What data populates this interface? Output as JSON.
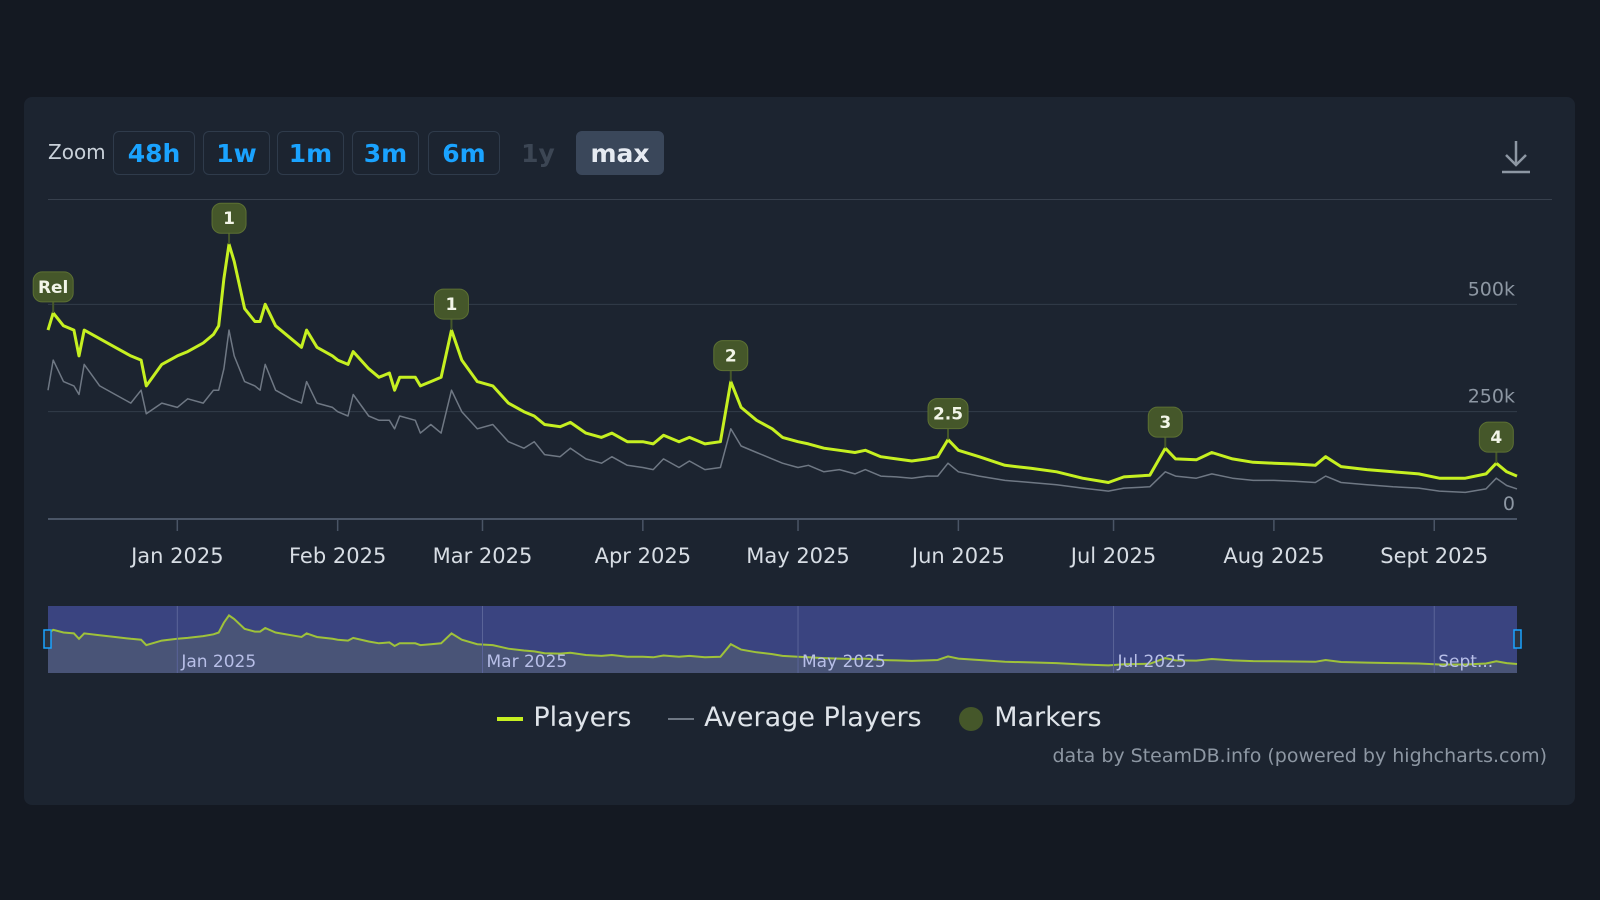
{
  "zoom": {
    "label": "Zoom",
    "buttons": [
      {
        "label": "48h",
        "state": "enabled"
      },
      {
        "label": "1w",
        "state": "enabled"
      },
      {
        "label": "1m",
        "state": "enabled"
      },
      {
        "label": "3m",
        "state": "enabled"
      },
      {
        "label": "6m",
        "state": "enabled"
      },
      {
        "label": "1y",
        "state": "disabled"
      },
      {
        "label": "max",
        "state": "active"
      }
    ]
  },
  "export_icon": "download-icon",
  "colors": {
    "background": "#141922",
    "panel": "#1c2430",
    "players": "#c6f021",
    "average": "#6f7884",
    "marker_fill": "#45572a",
    "zoom_text": "#1aa3ff",
    "navigator_mask": "#3a4480"
  },
  "chart_data": {
    "type": "line",
    "x_start": "2024-12-07",
    "x_end": "2025-09-17",
    "xlabel": "",
    "ylabel": "",
    "y_ticks": [
      0,
      250000,
      500000
    ],
    "y_tick_labels": [
      "0",
      "250k",
      "500k"
    ],
    "ylim": [
      0,
      750000
    ],
    "grid": true,
    "x_tick_labels": [
      "Jan 2025",
      "Feb 2025",
      "Mar 2025",
      "Apr 2025",
      "May 2025",
      "Jun 2025",
      "Jul 2025",
      "Aug 2025",
      "Sept 2025"
    ],
    "x_ticks": [
      "2025-01-01",
      "2025-02-01",
      "2025-03-01",
      "2025-04-01",
      "2025-05-01",
      "2025-06-01",
      "2025-07-01",
      "2025-08-01",
      "2025-09-01"
    ],
    "series": [
      {
        "name": "Players",
        "points": [
          [
            "2024-12-07",
            440000
          ],
          [
            "2024-12-08",
            480000
          ],
          [
            "2024-12-10",
            450000
          ],
          [
            "2024-12-12",
            440000
          ],
          [
            "2024-12-13",
            380000
          ],
          [
            "2024-12-14",
            440000
          ],
          [
            "2024-12-17",
            420000
          ],
          [
            "2024-12-20",
            400000
          ],
          [
            "2024-12-23",
            380000
          ],
          [
            "2024-12-25",
            370000
          ],
          [
            "2024-12-26",
            310000
          ],
          [
            "2024-12-29",
            360000
          ],
          [
            "2025-01-01",
            380000
          ],
          [
            "2025-01-03",
            390000
          ],
          [
            "2025-01-06",
            410000
          ],
          [
            "2025-01-08",
            430000
          ],
          [
            "2025-01-09",
            450000
          ],
          [
            "2025-01-10",
            560000
          ],
          [
            "2025-01-11",
            640000
          ],
          [
            "2025-01-12",
            600000
          ],
          [
            "2025-01-14",
            490000
          ],
          [
            "2025-01-16",
            460000
          ],
          [
            "2025-01-17",
            460000
          ],
          [
            "2025-01-18",
            500000
          ],
          [
            "2025-01-20",
            450000
          ],
          [
            "2025-01-23",
            420000
          ],
          [
            "2025-01-25",
            400000
          ],
          [
            "2025-01-26",
            440000
          ],
          [
            "2025-01-28",
            400000
          ],
          [
            "2025-01-31",
            380000
          ],
          [
            "2025-02-01",
            370000
          ],
          [
            "2025-02-03",
            360000
          ],
          [
            "2025-02-04",
            390000
          ],
          [
            "2025-02-07",
            350000
          ],
          [
            "2025-02-09",
            330000
          ],
          [
            "2025-02-11",
            340000
          ],
          [
            "2025-02-12",
            300000
          ],
          [
            "2025-02-13",
            330000
          ],
          [
            "2025-02-16",
            330000
          ],
          [
            "2025-02-17",
            310000
          ],
          [
            "2025-02-19",
            320000
          ],
          [
            "2025-02-21",
            330000
          ],
          [
            "2025-02-23",
            440000
          ],
          [
            "2025-02-25",
            370000
          ],
          [
            "2025-02-28",
            320000
          ],
          [
            "2025-03-03",
            310000
          ],
          [
            "2025-03-06",
            270000
          ],
          [
            "2025-03-09",
            250000
          ],
          [
            "2025-03-11",
            240000
          ],
          [
            "2025-03-13",
            220000
          ],
          [
            "2025-03-16",
            215000
          ],
          [
            "2025-03-18",
            225000
          ],
          [
            "2025-03-21",
            200000
          ],
          [
            "2025-03-24",
            190000
          ],
          [
            "2025-03-26",
            200000
          ],
          [
            "2025-03-29",
            180000
          ],
          [
            "2025-04-01",
            180000
          ],
          [
            "2025-04-03",
            175000
          ],
          [
            "2025-04-05",
            195000
          ],
          [
            "2025-04-08",
            180000
          ],
          [
            "2025-04-10",
            190000
          ],
          [
            "2025-04-13",
            175000
          ],
          [
            "2025-04-16",
            180000
          ],
          [
            "2025-04-18",
            320000
          ],
          [
            "2025-04-20",
            260000
          ],
          [
            "2025-04-23",
            230000
          ],
          [
            "2025-04-26",
            210000
          ],
          [
            "2025-04-28",
            190000
          ],
          [
            "2025-05-01",
            180000
          ],
          [
            "2025-05-03",
            175000
          ],
          [
            "2025-05-06",
            165000
          ],
          [
            "2025-05-09",
            160000
          ],
          [
            "2025-05-12",
            155000
          ],
          [
            "2025-05-14",
            160000
          ],
          [
            "2025-05-17",
            145000
          ],
          [
            "2025-05-20",
            140000
          ],
          [
            "2025-05-23",
            135000
          ],
          [
            "2025-05-26",
            140000
          ],
          [
            "2025-05-28",
            145000
          ],
          [
            "2025-05-30",
            185000
          ],
          [
            "2025-06-01",
            160000
          ],
          [
            "2025-06-05",
            145000
          ],
          [
            "2025-06-10",
            125000
          ],
          [
            "2025-06-15",
            118000
          ],
          [
            "2025-06-20",
            110000
          ],
          [
            "2025-06-25",
            95000
          ],
          [
            "2025-06-30",
            85000
          ],
          [
            "2025-07-03",
            98000
          ],
          [
            "2025-07-08",
            102000
          ],
          [
            "2025-07-11",
            165000
          ],
          [
            "2025-07-13",
            140000
          ],
          [
            "2025-07-17",
            138000
          ],
          [
            "2025-07-20",
            155000
          ],
          [
            "2025-07-24",
            140000
          ],
          [
            "2025-07-28",
            132000
          ],
          [
            "2025-08-01",
            130000
          ],
          [
            "2025-08-05",
            128000
          ],
          [
            "2025-08-09",
            125000
          ],
          [
            "2025-08-11",
            145000
          ],
          [
            "2025-08-14",
            122000
          ],
          [
            "2025-08-19",
            115000
          ],
          [
            "2025-08-24",
            110000
          ],
          [
            "2025-08-29",
            105000
          ],
          [
            "2025-09-02",
            95000
          ],
          [
            "2025-09-07",
            95000
          ],
          [
            "2025-09-11",
            105000
          ],
          [
            "2025-09-13",
            130000
          ],
          [
            "2025-09-15",
            110000
          ],
          [
            "2025-09-17",
            100000
          ]
        ]
      },
      {
        "name": "Average Players",
        "points": [
          [
            "2024-12-07",
            300000
          ],
          [
            "2024-12-08",
            370000
          ],
          [
            "2024-12-10",
            320000
          ],
          [
            "2024-12-12",
            310000
          ],
          [
            "2024-12-13",
            290000
          ],
          [
            "2024-12-14",
            360000
          ],
          [
            "2024-12-17",
            310000
          ],
          [
            "2024-12-20",
            290000
          ],
          [
            "2024-12-23",
            270000
          ],
          [
            "2024-12-25",
            300000
          ],
          [
            "2024-12-26",
            245000
          ],
          [
            "2024-12-29",
            270000
          ],
          [
            "2025-01-01",
            260000
          ],
          [
            "2025-01-03",
            280000
          ],
          [
            "2025-01-06",
            270000
          ],
          [
            "2025-01-08",
            300000
          ],
          [
            "2025-01-09",
            300000
          ],
          [
            "2025-01-10",
            350000
          ],
          [
            "2025-01-11",
            440000
          ],
          [
            "2025-01-12",
            380000
          ],
          [
            "2025-01-14",
            320000
          ],
          [
            "2025-01-16",
            310000
          ],
          [
            "2025-01-17",
            300000
          ],
          [
            "2025-01-18",
            360000
          ],
          [
            "2025-01-20",
            300000
          ],
          [
            "2025-01-23",
            280000
          ],
          [
            "2025-01-25",
            270000
          ],
          [
            "2025-01-26",
            320000
          ],
          [
            "2025-01-28",
            270000
          ],
          [
            "2025-01-31",
            260000
          ],
          [
            "2025-02-01",
            250000
          ],
          [
            "2025-02-03",
            240000
          ],
          [
            "2025-02-04",
            290000
          ],
          [
            "2025-02-07",
            240000
          ],
          [
            "2025-02-09",
            230000
          ],
          [
            "2025-02-11",
            230000
          ],
          [
            "2025-02-12",
            210000
          ],
          [
            "2025-02-13",
            240000
          ],
          [
            "2025-02-16",
            230000
          ],
          [
            "2025-02-17",
            200000
          ],
          [
            "2025-02-19",
            220000
          ],
          [
            "2025-02-21",
            200000
          ],
          [
            "2025-02-23",
            300000
          ],
          [
            "2025-02-25",
            250000
          ],
          [
            "2025-02-28",
            210000
          ],
          [
            "2025-03-03",
            220000
          ],
          [
            "2025-03-06",
            180000
          ],
          [
            "2025-03-09",
            165000
          ],
          [
            "2025-03-11",
            180000
          ],
          [
            "2025-03-13",
            150000
          ],
          [
            "2025-03-16",
            145000
          ],
          [
            "2025-03-18",
            165000
          ],
          [
            "2025-03-21",
            140000
          ],
          [
            "2025-03-24",
            130000
          ],
          [
            "2025-03-26",
            145000
          ],
          [
            "2025-03-29",
            125000
          ],
          [
            "2025-04-01",
            120000
          ],
          [
            "2025-04-03",
            115000
          ],
          [
            "2025-04-05",
            140000
          ],
          [
            "2025-04-08",
            120000
          ],
          [
            "2025-04-10",
            135000
          ],
          [
            "2025-04-13",
            115000
          ],
          [
            "2025-04-16",
            120000
          ],
          [
            "2025-04-18",
            210000
          ],
          [
            "2025-04-20",
            170000
          ],
          [
            "2025-04-23",
            155000
          ],
          [
            "2025-04-26",
            140000
          ],
          [
            "2025-04-28",
            130000
          ],
          [
            "2025-05-01",
            120000
          ],
          [
            "2025-05-03",
            125000
          ],
          [
            "2025-05-06",
            110000
          ],
          [
            "2025-05-09",
            115000
          ],
          [
            "2025-05-12",
            105000
          ],
          [
            "2025-05-14",
            115000
          ],
          [
            "2025-05-17",
            100000
          ],
          [
            "2025-05-20",
            98000
          ],
          [
            "2025-05-23",
            95000
          ],
          [
            "2025-05-26",
            100000
          ],
          [
            "2025-05-28",
            100000
          ],
          [
            "2025-05-30",
            130000
          ],
          [
            "2025-06-01",
            110000
          ],
          [
            "2025-06-05",
            100000
          ],
          [
            "2025-06-10",
            90000
          ],
          [
            "2025-06-15",
            85000
          ],
          [
            "2025-06-20",
            80000
          ],
          [
            "2025-06-25",
            72000
          ],
          [
            "2025-06-30",
            65000
          ],
          [
            "2025-07-03",
            72000
          ],
          [
            "2025-07-08",
            75000
          ],
          [
            "2025-07-11",
            110000
          ],
          [
            "2025-07-13",
            100000
          ],
          [
            "2025-07-17",
            95000
          ],
          [
            "2025-07-20",
            105000
          ],
          [
            "2025-07-24",
            95000
          ],
          [
            "2025-07-28",
            90000
          ],
          [
            "2025-08-01",
            90000
          ],
          [
            "2025-08-05",
            88000
          ],
          [
            "2025-08-09",
            85000
          ],
          [
            "2025-08-11",
            100000
          ],
          [
            "2025-08-14",
            85000
          ],
          [
            "2025-08-19",
            80000
          ],
          [
            "2025-08-24",
            75000
          ],
          [
            "2025-08-29",
            72000
          ],
          [
            "2025-09-02",
            65000
          ],
          [
            "2025-09-07",
            62000
          ],
          [
            "2025-09-11",
            70000
          ],
          [
            "2025-09-13",
            95000
          ],
          [
            "2025-09-15",
            78000
          ],
          [
            "2025-09-17",
            70000
          ]
        ]
      }
    ],
    "markers": [
      {
        "label": "Rel",
        "date": "2024-12-08",
        "value": 480000
      },
      {
        "label": "1",
        "date": "2025-01-11",
        "value": 640000
      },
      {
        "label": "1",
        "date": "2025-02-23",
        "value": 440000
      },
      {
        "label": "2",
        "date": "2025-04-18",
        "value": 320000
      },
      {
        "label": "2.5",
        "date": "2025-05-30",
        "value": 185000
      },
      {
        "label": "3",
        "date": "2025-07-11",
        "value": 165000
      },
      {
        "label": "4",
        "date": "2025-09-13",
        "value": 130000
      }
    ],
    "navigator": {
      "tick_labels": [
        "Jan 2025",
        "Mar 2025",
        "May 2025",
        "Jul 2025",
        "Sept..."
      ],
      "ticks": [
        "2025-01-01",
        "2025-03-01",
        "2025-05-01",
        "2025-07-01",
        "2025-09-01"
      ]
    },
    "legend": {
      "placement": "bottom-center",
      "items": [
        {
          "label": "Players",
          "symbol": "line"
        },
        {
          "label": "Average Players",
          "symbol": "line-thin"
        },
        {
          "label": "Markers",
          "symbol": "circle"
        }
      ]
    },
    "credits": "data by SteamDB.info (powered by highcharts.com)"
  }
}
